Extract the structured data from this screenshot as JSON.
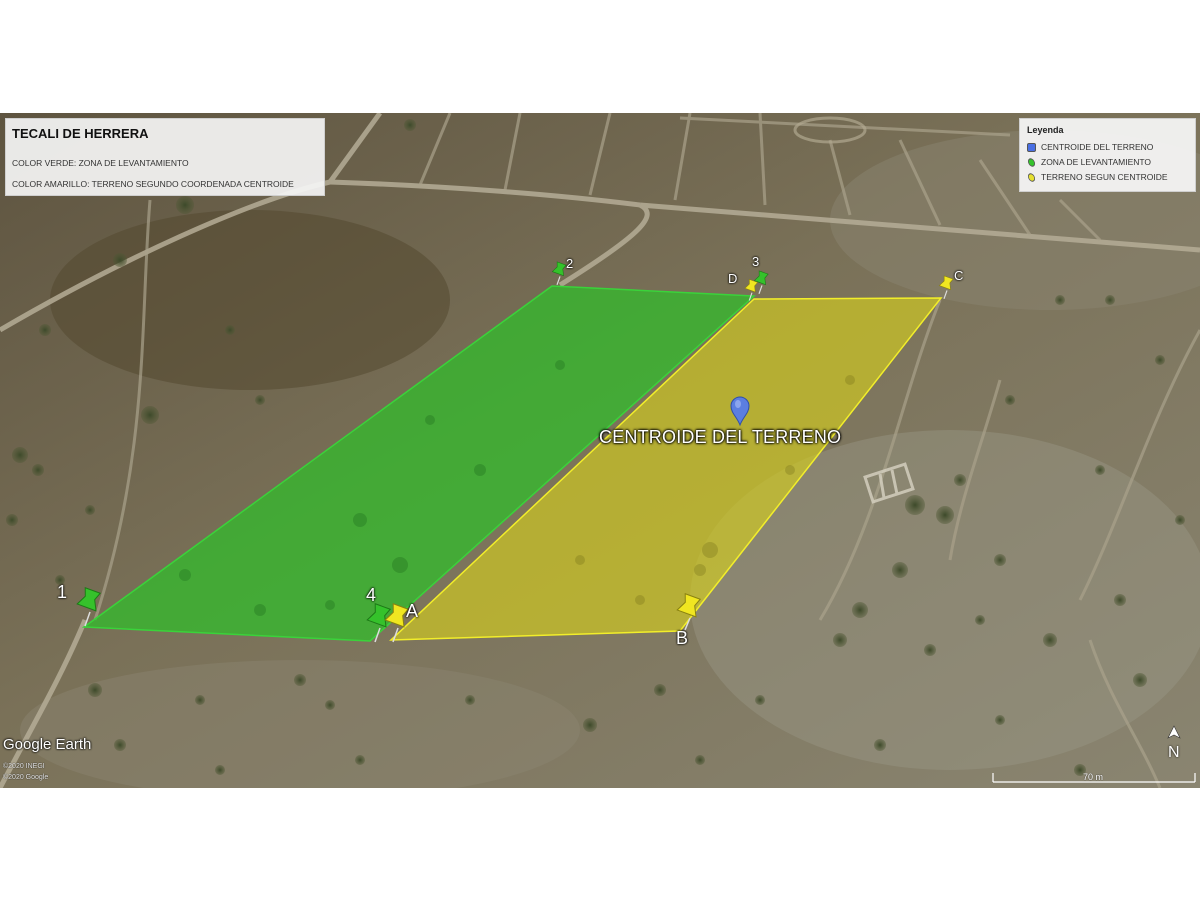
{
  "info": {
    "title": "TECALI DE HERRERA",
    "line1": "COLOR VERDE: ZONA DE LEVANTAMIENTO",
    "line2": "COLOR AMARILLO: TERRENO SEGUNDO COORDENADA CENTROIDE"
  },
  "legend": {
    "title": "Leyenda",
    "items": [
      {
        "label": "CENTROIDE DEL TERRENO",
        "color": "#4a6fe3",
        "icon": "centroid-swatch"
      },
      {
        "label": "ZONA DE LEVANTAMIENTO",
        "color": "#35c22b",
        "icon": "green-zone-swatch"
      },
      {
        "label": "TERRENO SEGUN CENTROIDE",
        "color": "#e6e030",
        "icon": "yellow-zone-swatch"
      }
    ]
  },
  "map": {
    "centroid_label": "CENTROIDE DEL TERRENO",
    "green_pins": [
      "1",
      "2",
      "3",
      "4"
    ],
    "yellow_pins": [
      "A",
      "B",
      "C",
      "D"
    ],
    "colors": {
      "green_zone": "#2fbf2a",
      "yellow_zone": "#d9d21c",
      "centroid_pin": "#5b7ee0"
    }
  },
  "footer": {
    "brand": "Google Earth",
    "credit1": "©2020 INEGI",
    "credit2": "©2020 Google",
    "scale": "70 m",
    "north": "N"
  }
}
